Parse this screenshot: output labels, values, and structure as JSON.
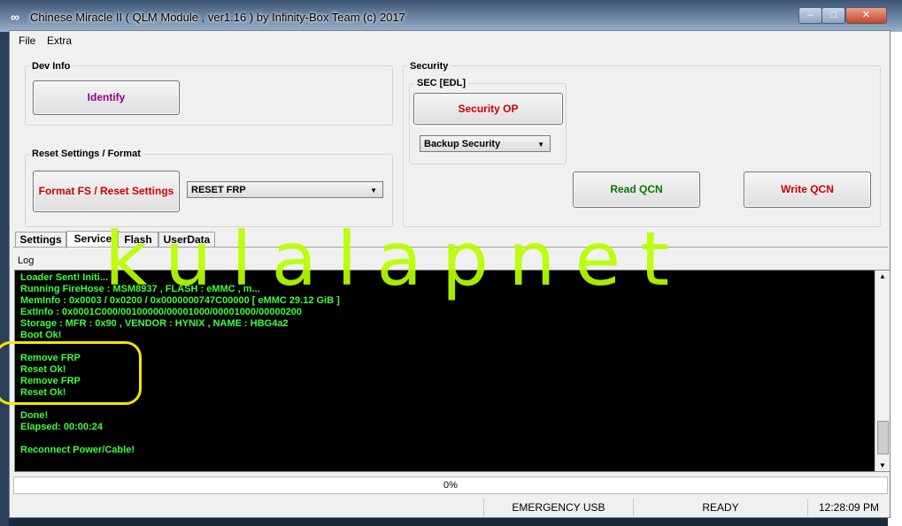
{
  "window": {
    "title": "Chinese Miracle II ( QLM Module , ver1.16 ) by Infinity-Box Team (c) 2017",
    "icon": "infinity-icon"
  },
  "menu": {
    "file": "File",
    "extra": "Extra"
  },
  "dev_info": {
    "label": "Dev Info",
    "identify_button": "Identify"
  },
  "reset": {
    "label": "Reset Settings / Format",
    "format_button": "Format FS / Reset Settings",
    "combo_value": "RESET FRP"
  },
  "security": {
    "label": "Security",
    "sec_label": "SEC [EDL]",
    "security_op_button": "Security OP",
    "combo_value": "Backup Security",
    "read_qcn_button": "Read QCN",
    "write_qcn_button": "Write QCN"
  },
  "tabs": [
    {
      "label": "Settings"
    },
    {
      "label": "Service"
    },
    {
      "label": "Flash"
    },
    {
      "label": "UserData"
    }
  ],
  "log": {
    "label": "Log",
    "lines": "Loader Sent! Initi...\nRunning FireHose : MSM8937 , FLASH : eMMC , m...\nMemInfo : 0x0003 / 0x0200 / 0x0000000747C00000 [ eMMC 29.12 GiB ]\nExtInfo : 0x0001C000/00100000/00001000/00001000/00000200\nStorage : MFR : 0x90 , VENDOR : HYNIX , NAME : HBG4a2\nBoot Ok!\n\nRemove FRP\nReset Ok!\nRemove FRP\nReset Ok!\n\nDone!\nElapsed: 00:00:24\n\nReconnect Power/Cable!"
  },
  "progress": "0%",
  "status": {
    "mode": "EMERGENCY USB",
    "state": "READY",
    "time": "12:28:09 PM"
  },
  "watermark": "kulalapnet",
  "colors": {
    "identify": "#8b008b",
    "format": "#cc0000",
    "security_op": "#cc0000",
    "read_qcn": "#007a00",
    "write_qcn": "#cc0000",
    "log_text": "#3cff3c",
    "watermark": "#b8ff00",
    "highlight_circle": "#f2e600"
  }
}
